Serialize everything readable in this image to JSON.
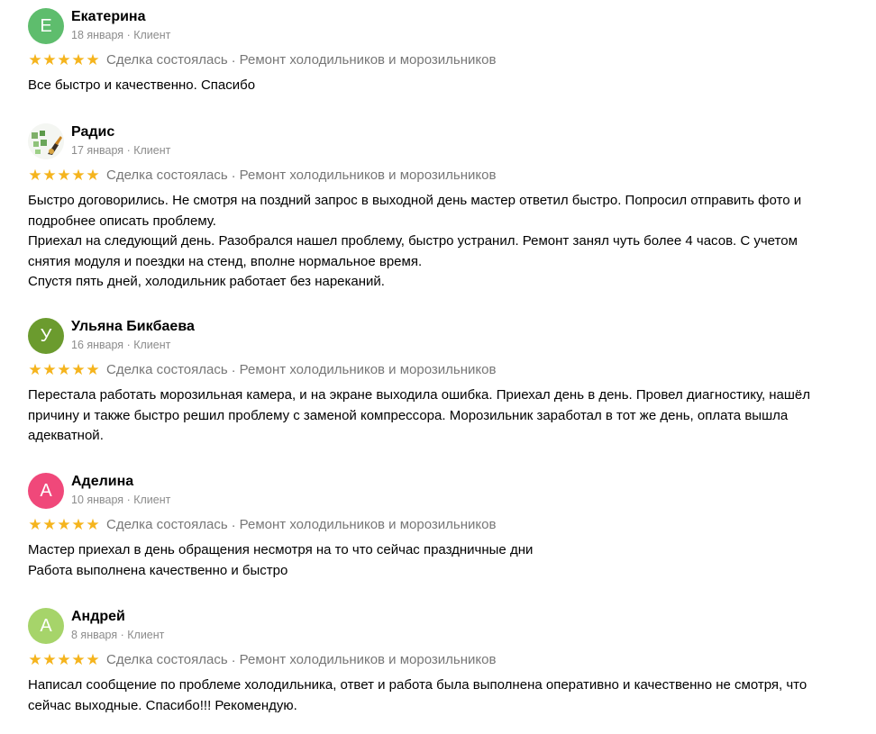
{
  "colors": {
    "star": "#f5b41d",
    "meta_text": "#8c8c8c",
    "body_text": "#000000"
  },
  "reviews": [
    {
      "initial": "Е",
      "avatar_color": "#5ebd6d",
      "name": "Екатерина",
      "date": "18 января",
      "role": "Клиент",
      "rating": 5,
      "status": "Сделка состоялась",
      "service": "Ремонт холодильников и морозильников",
      "paragraphs": [
        "Все быстро и качественно. Спасибо"
      ]
    },
    {
      "initial": "",
      "avatar_color": "#f3f3f3",
      "name": "Радис",
      "date": "17 января",
      "role": "Клиент",
      "rating": 5,
      "status": "Сделка состоялась",
      "service": "Ремонт холодильников и морозильников",
      "paragraphs": [
        "Быстро договорились. Не смотря на поздний запрос в выходной день мастер ответил быстро. Попросил отправить фото и подробнее описать проблему.",
        "Приехал на следующий день. Разобрался нашел проблему, быстро устранил. Ремонт занял чуть более 4 часов. С учетом снятия модуля и поездки на стенд, вполне нормальное время.",
        "Спустя пять дней, холодильник работает без нареканий."
      ]
    },
    {
      "initial": "У",
      "avatar_color": "#6b9b2e",
      "name": "Ульяна Бикбаева",
      "date": "16 января",
      "role": "Клиент",
      "rating": 5,
      "status": "Сделка состоялась",
      "service": "Ремонт холодильников и морозильников",
      "paragraphs": [
        "Перестала работать морозильная камера, и на экране выходила ошибка. Приехал день в день. Провел диагностику, нашёл причину и также быстро решил проблему с заменой компрессора. Морозильник заработал в тот же день, оплата вышла адекватной."
      ]
    },
    {
      "initial": "А",
      "avatar_color": "#f0487a",
      "name": "Аделина",
      "date": "10 января",
      "role": "Клиент",
      "rating": 5,
      "status": "Сделка состоялась",
      "service": "Ремонт холодильников и морозильников",
      "paragraphs": [
        "Мастер приехал в день обращения несмотря на то что сейчас праздничные дни",
        "Работа выполнена качественно и быстро"
      ]
    },
    {
      "initial": "А",
      "avatar_color": "#a6d46a",
      "name": "Андрей",
      "date": "8 января",
      "role": "Клиент",
      "rating": 5,
      "status": "Сделка состоялась",
      "service": "Ремонт холодильников и морозильников",
      "paragraphs": [
        "Написал сообщение по проблеме холодильника, ответ и работа была выполнена оперативно и качественно не смотря, что сейчас выходные. Спасибо!!! Рекомендую."
      ]
    }
  ]
}
